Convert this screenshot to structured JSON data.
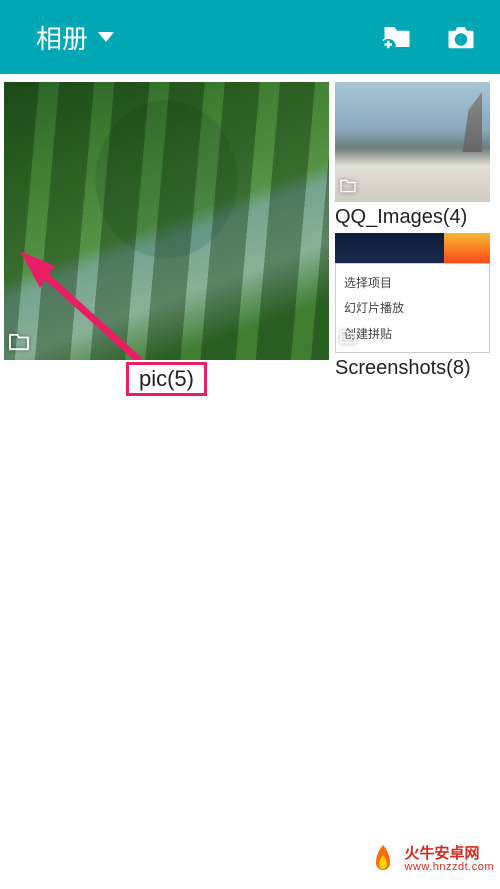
{
  "header": {
    "title": "相册"
  },
  "albums": {
    "main": {
      "label": "pic(5)"
    },
    "qq": {
      "label": "QQ_Images(4)"
    },
    "screenshots": {
      "label": "Screenshots(8)",
      "menu": {
        "item0": "选择项目",
        "item1": "幻灯片播放",
        "item2": "创建拼贴"
      }
    }
  },
  "watermark": {
    "line1": "火牛安卓网",
    "line2": "www.hnzzdt.com"
  }
}
